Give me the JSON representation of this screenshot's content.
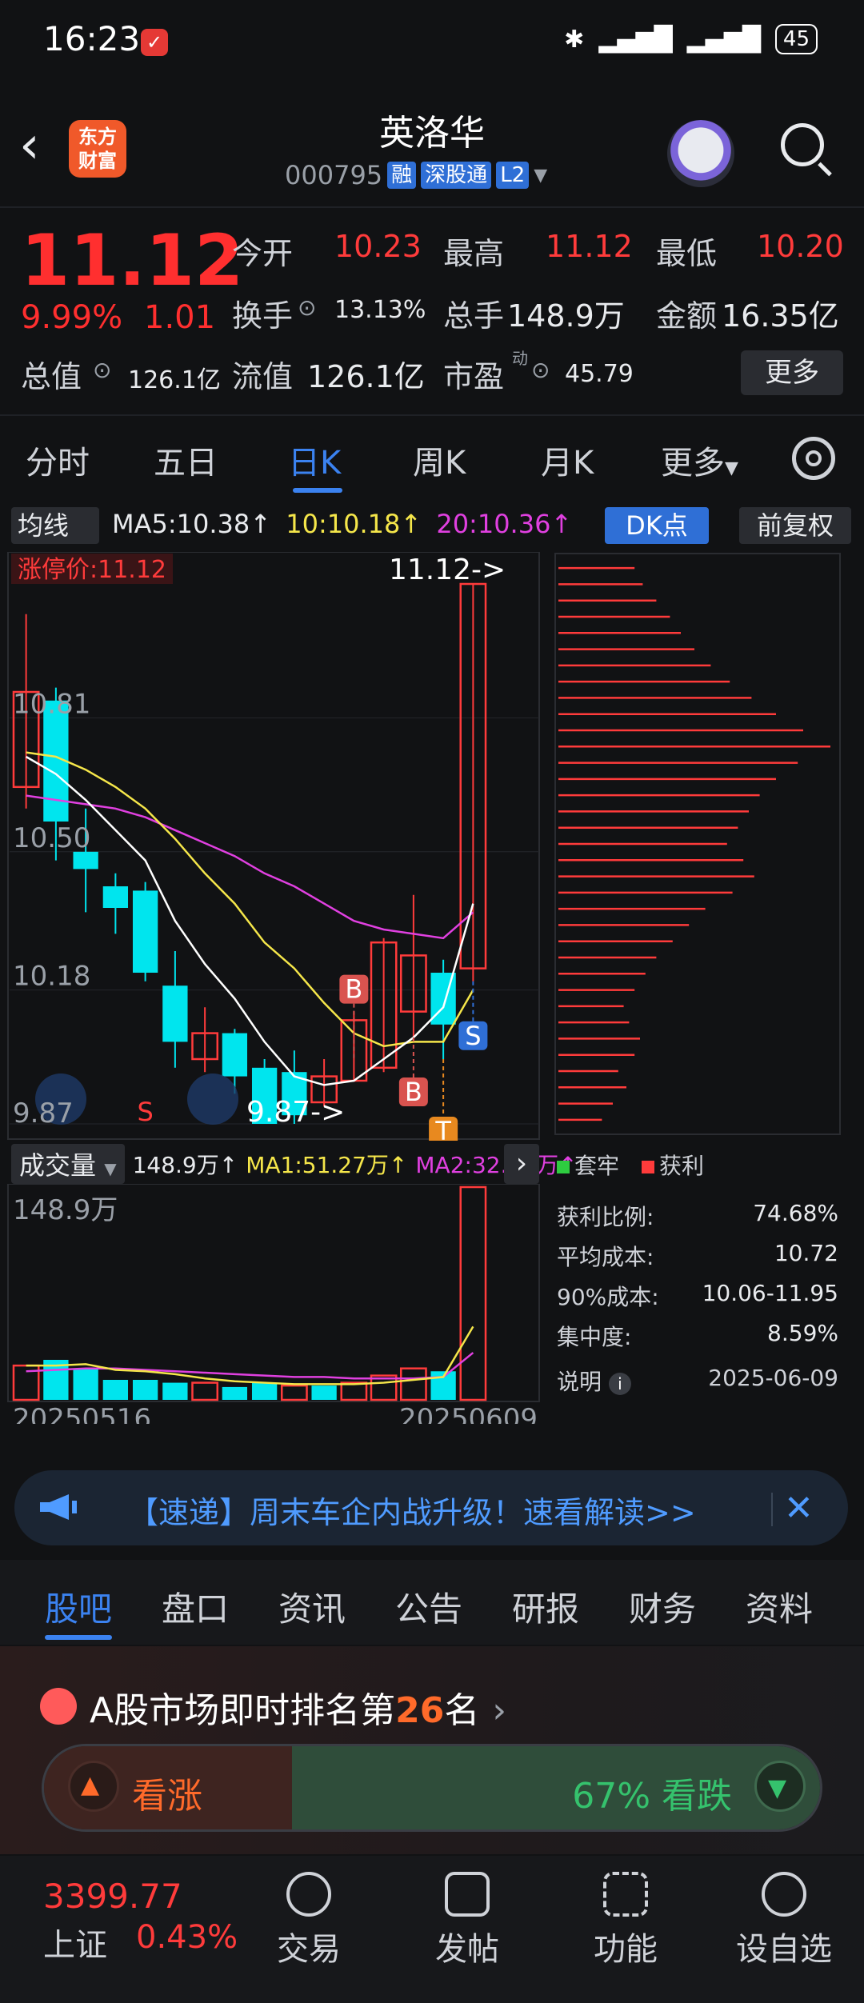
{
  "statusbar": {
    "time": "16:23",
    "battery": "45",
    "signal": "5G ▮▮▮▮"
  },
  "header": {
    "brand": "东方\n财富",
    "stock_name": "英洛华",
    "code": "000795",
    "tags": [
      "融",
      "深股通",
      "L2"
    ]
  },
  "quote": {
    "price": "11.12",
    "change_pct": "9.99%",
    "change": "1.01",
    "open_label": "今开",
    "open": "10.23",
    "high_label": "最高",
    "high": "11.12",
    "low_label": "最低",
    "low": "10.20",
    "turnover_label": "换手",
    "turnover": "13.13%",
    "volume_label": "总手",
    "volume": "148.9万",
    "amount_label": "金额",
    "amount": "16.35亿",
    "mktcap_label": "总值",
    "mktcap": "126.1亿",
    "float_label": "流值",
    "float": "126.1亿",
    "pe_label": "市盈",
    "pe_sup": "动",
    "pe": "45.79",
    "more": "更多"
  },
  "period_tabs": [
    "分时",
    "五日",
    "日K",
    "周K",
    "月K",
    "更多"
  ],
  "active_tab": "日K",
  "chart_header": {
    "ma_button": "均线",
    "ma5": "MA5:10.38↑",
    "ma10": "10:10.18↑",
    "ma20": "20:10.36↑",
    "dk_button": "DK点",
    "adj_button": "前复权"
  },
  "colors": {
    "up": "#ff3b3b",
    "down": "#00e5ee",
    "ma5": "#ffffff",
    "ma10": "#f5e64a",
    "ma20": "#e040e0",
    "accent": "#3b82f0"
  },
  "chart_data": [
    {
      "type": "candlestick",
      "y_ticks": [
        "10.81",
        "10.50",
        "10.18",
        "9.87"
      ],
      "ylim": [
        9.87,
        11.12
      ],
      "limit_label": "涨停价:11.12",
      "high_marker": "11.12->",
      "low_marker": "9.87->",
      "candles": [
        {
          "o": 10.65,
          "c": 10.87,
          "h": 11.05,
          "l": 10.6
        },
        {
          "o": 10.85,
          "c": 10.57,
          "h": 10.88,
          "l": 10.48
        },
        {
          "o": 10.5,
          "c": 10.46,
          "h": 10.6,
          "l": 10.36
        },
        {
          "o": 10.42,
          "c": 10.37,
          "h": 10.45,
          "l": 10.31
        },
        {
          "o": 10.41,
          "c": 10.22,
          "h": 10.43,
          "l": 10.2
        },
        {
          "o": 10.19,
          "c": 10.06,
          "h": 10.27,
          "l": 10.0
        },
        {
          "o": 10.02,
          "c": 10.08,
          "h": 10.14,
          "l": 9.99
        },
        {
          "o": 10.08,
          "c": 9.98,
          "h": 10.09,
          "l": 9.94
        },
        {
          "o": 10.0,
          "c": 9.87,
          "h": 10.02,
          "l": 9.87
        },
        {
          "o": 9.99,
          "c": 9.89,
          "h": 10.04,
          "l": 9.87
        },
        {
          "o": 9.92,
          "c": 9.98,
          "h": 10.02,
          "l": 9.91
        },
        {
          "o": 9.97,
          "c": 10.11,
          "h": 10.13,
          "l": 9.97
        },
        {
          "o": 10.0,
          "c": 10.29,
          "h": 10.3,
          "l": 9.99
        },
        {
          "o": 10.13,
          "c": 10.26,
          "h": 10.4,
          "l": 10.07
        },
        {
          "o": 10.22,
          "c": 10.1,
          "h": 10.25,
          "l": 10.02
        },
        {
          "o": 10.23,
          "c": 11.12,
          "h": 11.12,
          "l": 10.2
        }
      ],
      "ma5": [
        10.72,
        10.68,
        10.62,
        10.55,
        10.48,
        10.34,
        10.24,
        10.16,
        10.06,
        9.98,
        9.96,
        9.97,
        10.02,
        10.07,
        10.14,
        10.38
      ],
      "ma10": [
        10.73,
        10.72,
        10.69,
        10.65,
        10.6,
        10.53,
        10.45,
        10.38,
        10.29,
        10.23,
        10.15,
        10.08,
        10.05,
        10.06,
        10.06,
        10.18
      ],
      "ma20": [
        10.63,
        10.62,
        10.61,
        10.6,
        10.58,
        10.55,
        10.52,
        10.49,
        10.45,
        10.42,
        10.38,
        10.34,
        10.32,
        10.31,
        10.3,
        10.36
      ],
      "signals": [
        {
          "label": "S",
          "index": 4
        },
        {
          "label": "B",
          "index": 11
        },
        {
          "label": "B",
          "index": 13
        },
        {
          "label": "T",
          "index": 14
        },
        {
          "label": "S",
          "index": 15
        }
      ]
    },
    {
      "type": "bar",
      "title": "成交量",
      "max_label": "148.9万",
      "x_start": "20250516",
      "x_end": "20250609",
      "values": [
        24,
        28,
        22,
        14,
        14,
        12,
        12,
        9,
        12,
        10,
        10,
        12,
        17,
        22,
        20,
        148.9
      ],
      "up_flags": [
        true,
        false,
        false,
        false,
        false,
        false,
        true,
        false,
        false,
        true,
        false,
        true,
        true,
        true,
        false,
        true
      ],
      "ma1": [
        24,
        24,
        25,
        21,
        20,
        18,
        15,
        13,
        12,
        11,
        11,
        11,
        12,
        14,
        16,
        51.27
      ],
      "ma2": [
        20,
        21,
        22,
        22,
        21,
        20,
        19,
        18,
        17,
        16,
        16,
        15,
        15,
        15,
        16,
        32.99
      ],
      "ma1_label": "MA1:51.27万↑",
      "ma2_label": "MA2:32.99万↑",
      "volume_label": "148.9万↑"
    }
  ],
  "distribution": {
    "legend_trapped": "套牢",
    "legend_profit": "获利",
    "bars": [
      0.28,
      0.31,
      0.36,
      0.41,
      0.45,
      0.5,
      0.56,
      0.63,
      0.71,
      0.8,
      0.9,
      1.0,
      0.88,
      0.8,
      0.74,
      0.7,
      0.66,
      0.62,
      0.68,
      0.72,
      0.64,
      0.54,
      0.48,
      0.42,
      0.36,
      0.32,
      0.28,
      0.24,
      0.26,
      0.3,
      0.28,
      0.22,
      0.25,
      0.2,
      0.16
    ],
    "profit_ratio_label": "获利比例:",
    "profit_ratio": "74.68%",
    "avg_cost_label": "平均成本:",
    "avg_cost": "10.72",
    "cost90_label": "90%成本:",
    "cost90": "10.06-11.95",
    "concentration_label": "集中度:",
    "concentration": "8.59%",
    "note_label": "说明",
    "date": "2025-06-09"
  },
  "banner": {
    "text": "【速递】周末车企内战升级！速看解读>>"
  },
  "content_tabs": [
    "股吧",
    "盘口",
    "资讯",
    "公告",
    "研报",
    "财务",
    "资料"
  ],
  "active_content_tab": "股吧",
  "ranking": {
    "prefix": "A股市场即时排名第",
    "rank": "26",
    "suffix": "名"
  },
  "vote": {
    "up_label": "看涨",
    "down_label": "67% 看跌"
  },
  "bottom_nav": {
    "index_value": "3399.77",
    "index_name": "上证",
    "index_change": "0.43%",
    "items": [
      "交易",
      "发帖",
      "功能",
      "设自选"
    ]
  }
}
